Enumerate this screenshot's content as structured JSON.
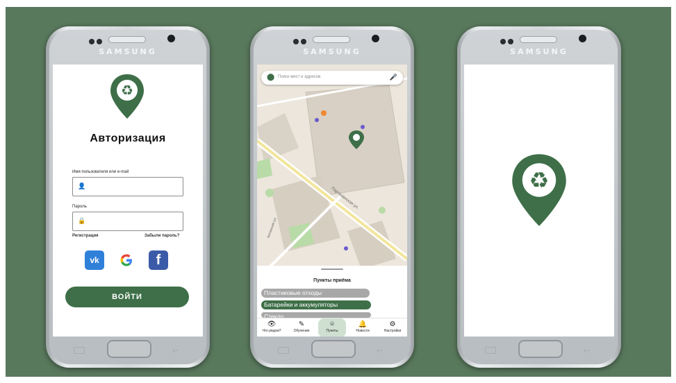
{
  "brand": "SAMSUNG",
  "colors": {
    "accent": "#3e6f48",
    "backdrop": "#59795d"
  },
  "login": {
    "title": "Авторизация",
    "username_label": "Имя пользователя или e-mail",
    "password_label": "Пароль",
    "register_link": "Регистрация",
    "forgot_link": "Забыли пароль?",
    "social": [
      "vk-icon",
      "google-icon",
      "facebook-icon"
    ],
    "login_button": "ВОЙТИ"
  },
  "map": {
    "search_placeholder": "Поиск мест и адресов",
    "street_label": "Партизанская ул.",
    "street2_label": "Котовская ул.",
    "sheet_title": "Пункты приёма",
    "chips": [
      "Пластиковые отходы",
      "Батарейки и аккумуляторы",
      "Стекло"
    ],
    "tabs": [
      {
        "label": "Что рядом?",
        "icon": "eye-icon"
      },
      {
        "label": "Обучение",
        "icon": "edit-icon"
      },
      {
        "label": "Пункты",
        "icon": "pin-icon",
        "active": true
      },
      {
        "label": "Новости",
        "icon": "bell-icon"
      },
      {
        "label": "Настройки",
        "icon": "gear-icon"
      }
    ]
  }
}
